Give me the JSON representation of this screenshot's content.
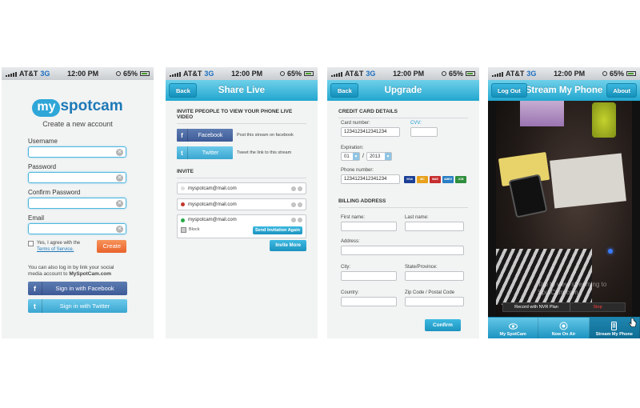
{
  "status": {
    "carrier": "AT&T",
    "network": "3G",
    "time": "12:00 PM",
    "battery": "65%"
  },
  "screen1": {
    "logo_my": "my",
    "logo_rest": "spotcam",
    "subtitle": "Create a new account",
    "fields": [
      {
        "label": "Username"
      },
      {
        "label": "Password"
      },
      {
        "label": "Confirm Password"
      },
      {
        "label": "Email"
      }
    ],
    "agree_text": "Yes, I agree with the",
    "terms_link": "Terms of Service.",
    "create_label": "Create",
    "social_text_1": "You can also log in by link your social media account to",
    "social_text_2": "MySpotCam.com",
    "facebook_label": "Sign in with Facebook",
    "twitter_label": "Sign in with Twitter",
    "facebook_icon_char": "f",
    "twitter_icon_char": "t"
  },
  "screen2": {
    "back_label": "Back",
    "title": "Share Live",
    "invite_heading": "INVITE PPEOPLE TO VIEW YOUR PHONE LIVE VIDEO",
    "facebook_label": "Facebook",
    "facebook_desc": "Post this stream on facebook",
    "twitter_label": "Twitter",
    "twitter_desc": "Tweet the link to this stream",
    "invite_section": "INVITE",
    "invitees": [
      {
        "email": "myspotcam@mail.com",
        "color": "#dddddd"
      },
      {
        "email": "myspotcam@mail.com",
        "color": "#c0392b"
      },
      {
        "email": "myspotcam@mail.com",
        "color": "#27a844"
      }
    ],
    "block_label": "Block",
    "send_again_label": "Send Invitation Again",
    "invite_more_label": "Invite More"
  },
  "screen3": {
    "back_label": "Back",
    "title": "Upgrade",
    "cc_heading": "CREDIT CARD DETAILS",
    "card_number_label": "Card number:",
    "card_number_value": "1234123412341234",
    "cvv_label": "CVV:",
    "expiration_label": "Expiration:",
    "exp_month": "01",
    "exp_year": "2013",
    "exp_sep": "/",
    "phone_label": "Phone number:",
    "phone_value": "1234123412341234",
    "card_brands": [
      "VISA",
      "MC",
      "MAE",
      "AMEX",
      "JCB"
    ],
    "billing_heading": "BILLING ADDRESS",
    "first_name_label": "First name:",
    "last_name_label": "Last name:",
    "address_label": "Address:",
    "city_label": "City:",
    "state_label": "State/Province:",
    "country_label": "Country:",
    "zip_label": "Zip Code / Postal Code",
    "confirm_label": "Confirm"
  },
  "screen4": {
    "logout_label": "Log Out",
    "title": "Stream My Phone",
    "about_label": "About",
    "overlay_text_1": "Tap to view streaming to",
    "overlay_text_2": "SpotCam.com",
    "record_label": "Record with NVR Plan",
    "stop_label": "Stop",
    "tabs": [
      {
        "label": "My SpotCam",
        "icon": "eye-icon"
      },
      {
        "label": "Now On Air",
        "icon": "broadcast-icon"
      },
      {
        "label": "Stream My Phone",
        "icon": "phone-icon"
      }
    ]
  }
}
